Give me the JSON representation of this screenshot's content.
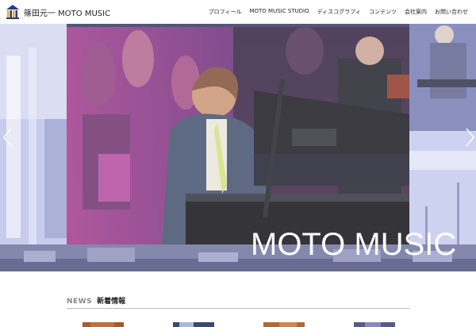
{
  "site": {
    "title": "篠田元一 MOTO MUSIC",
    "logo_icon": "building-columns-logo-icon"
  },
  "nav": {
    "items": [
      {
        "label": "プロフィール"
      },
      {
        "label": "MOTO MUSIC STUDIO"
      },
      {
        "label": "ディスコグラフィ"
      },
      {
        "label": "コンテンツ"
      },
      {
        "label": "会社案内"
      },
      {
        "label": "お問い合わせ"
      }
    ]
  },
  "hero": {
    "caption": "MOTO MUSIC",
    "prev_icon": "chevron-left-icon",
    "next_icon": "chevron-right-icon"
  },
  "news": {
    "heading_en": "NEWS",
    "heading_jp": "新着情報",
    "thumbnail_count": 4
  },
  "colors": {
    "accent": "#2a3a8a",
    "text": "#222222",
    "muted": "#888888"
  }
}
